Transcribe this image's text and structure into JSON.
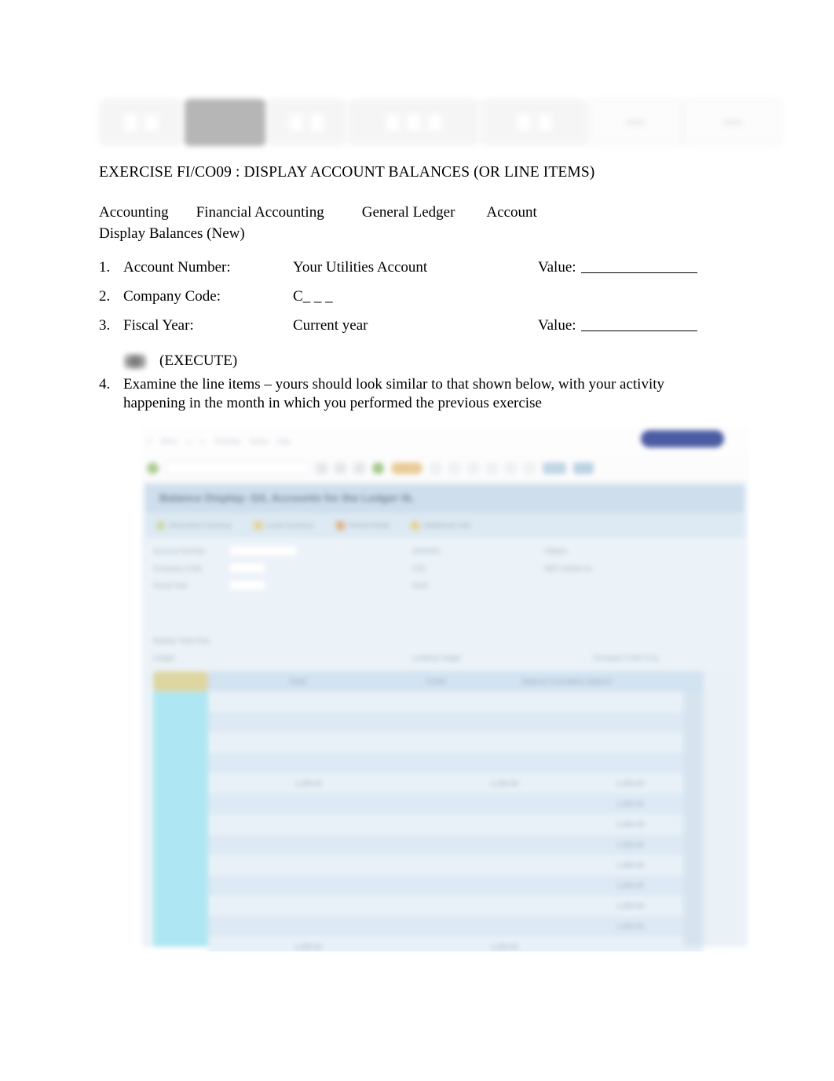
{
  "document": {
    "title": "EXERCISE FI/CO09  :  DISPLAY ACCOUNT BALANCES (OR LINE ITEMS)",
    "menu_path": {
      "segments": [
        "Accounting",
        "Financial Accounting",
        "General Ledger",
        "Account",
        "Display Balances (New)"
      ],
      "separator": "\u001a"
    },
    "items": [
      {
        "num": "1.",
        "label": "Account Number:",
        "value": "Your Utilities Account",
        "value_label": "Value:",
        "has_blank": true
      },
      {
        "num": "2.",
        "label": "Company Code:",
        "value": "C_ _ _",
        "value_label": "",
        "has_blank": false
      },
      {
        "num": "3.",
        "label": "Fiscal Year:",
        "value": "Current year",
        "value_label": "Value:",
        "has_blank": true
      }
    ],
    "execute": {
      "bullet": "\u001a",
      "icon": "execute-clock-icon",
      "label": "(EXECUTE)"
    },
    "item4": {
      "num": "4.",
      "text": "Examine the line items – yours should look similar to that shown below, with your activity happening in the month in which you performed the previous exercise"
    }
  },
  "ribbon": {
    "groups": [
      {
        "name": "clipboard-group",
        "label": ""
      },
      {
        "name": "font-group",
        "label": ""
      },
      {
        "name": "paragraph-group",
        "label": ""
      },
      {
        "name": "styles-group",
        "label": ""
      },
      {
        "name": "editing-group",
        "label": ""
      },
      {
        "name": "button-group-1",
        "label": ""
      },
      {
        "name": "button-group-2",
        "label": ""
      }
    ]
  },
  "screenshot": {
    "alt": "Blurred SAP GUI screenshot of G/L Account Balance Display",
    "accent_blue": "#3d4f9c",
    "title_bar_bg": "#cbdceb",
    "selected_column": "#a8e6f2",
    "window_title": "",
    "menu_items": [
      "",
      "",
      "",
      "",
      "",
      "",
      ""
    ],
    "app_toolbar_items": [
      "",
      "",
      ""
    ],
    "form_labels": [
      "",
      "",
      ""
    ],
    "grid_headers": [
      "",
      "",
      ""
    ],
    "grid_rows": [
      [],
      [],
      [],
      [],
      [],
      [],
      [],
      [],
      [],
      [],
      [],
      []
    ]
  }
}
